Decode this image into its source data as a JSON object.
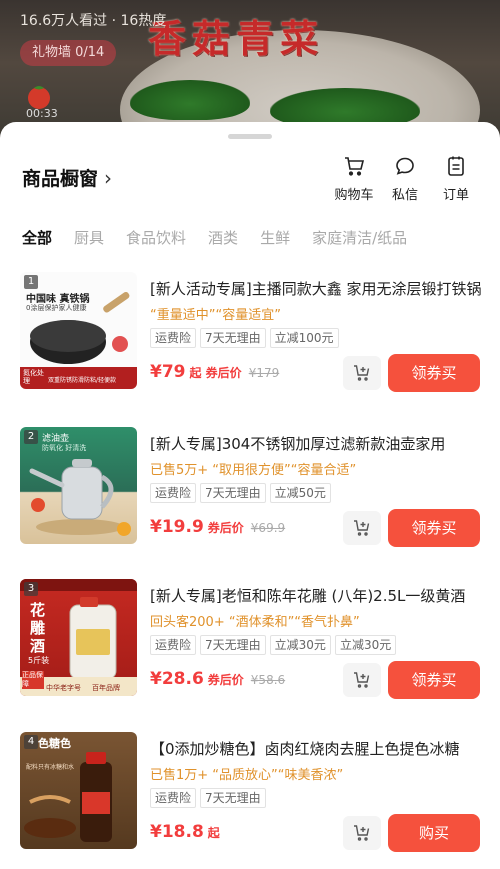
{
  "live": {
    "viewers": "16.6万人看过 · 16热度",
    "gift_wall": "礼物墙 0/14",
    "title": "香菇青菜",
    "time": "00:33"
  },
  "sheet": {
    "title": "商品橱窗",
    "actions": [
      {
        "label": "购物车",
        "icon": "cart-icon"
      },
      {
        "label": "私信",
        "icon": "chat-bubble-icon"
      },
      {
        "label": "订单",
        "icon": "order-list-icon"
      }
    ],
    "tabs": [
      "全部",
      "厨具",
      "食品饮料",
      "酒类",
      "生鲜",
      "家庭清洁/纸品"
    ]
  },
  "products": [
    {
      "index": "1",
      "name": "[新人活动专属]主播同款大鑫 家用无涂层锻打铁锅",
      "sub": "“重量适中”“容量适宜”",
      "tags": [
        "运费险",
        "7天无理由",
        "立减100元"
      ],
      "price": "¥79",
      "price_suffix": "起 券后价",
      "price_old": "¥179",
      "button": "领券买",
      "thumb_text": [
        "中国味 真铁锅",
        "0涂层保护家人健康",
        "氮化处理",
        "双重防锈防滑防粘/轻便款"
      ]
    },
    {
      "index": "2",
      "name": "[新人专属]304不锈钢加厚过滤新款油壶家用",
      "sub": "已售5万+ “取用很方便”“容量合适”",
      "tags": [
        "运费险",
        "7天无理由",
        "立减50元"
      ],
      "price": "¥19.9",
      "price_suffix": "券后价",
      "price_old": "¥69.9",
      "button": "领券买",
      "thumb_text": [
        "滤油壶",
        "防氧化 好清洗"
      ]
    },
    {
      "index": "3",
      "name": "[新人专属]老恒和陈年花雕 (八年)2.5L一级黄酒",
      "sub": "回头客200+ “酒体柔和”“香气扑鼻”",
      "tags": [
        "运费险",
        "7天无理由",
        "立减30元",
        "立减30元"
      ],
      "price": "¥28.6",
      "price_suffix": "券后价",
      "price_old": "¥58.6",
      "button": "领券买",
      "thumb_text": [
        "花",
        "雕",
        "酒",
        "5斤装",
        "中华老字号",
        "百年品牌",
        "正品保障"
      ]
    },
    {
      "index": "4",
      "name": "【0添加炒糖色】卤肉红烧肉去腥上色提色冰糖",
      "sub": "已售1万+ “品质放心”“味美香浓”",
      "tags": [
        "运费险",
        "7天无理由"
      ],
      "price": "¥18.8",
      "price_suffix": "起",
      "price_old": "",
      "button": "购买",
      "thumb_text": [
        "色糖色",
        "配料只有冰糖和水"
      ]
    }
  ],
  "colors": {
    "accent": "#f5513d",
    "price": "#f23d3d",
    "subtitle": "#e0922c"
  }
}
